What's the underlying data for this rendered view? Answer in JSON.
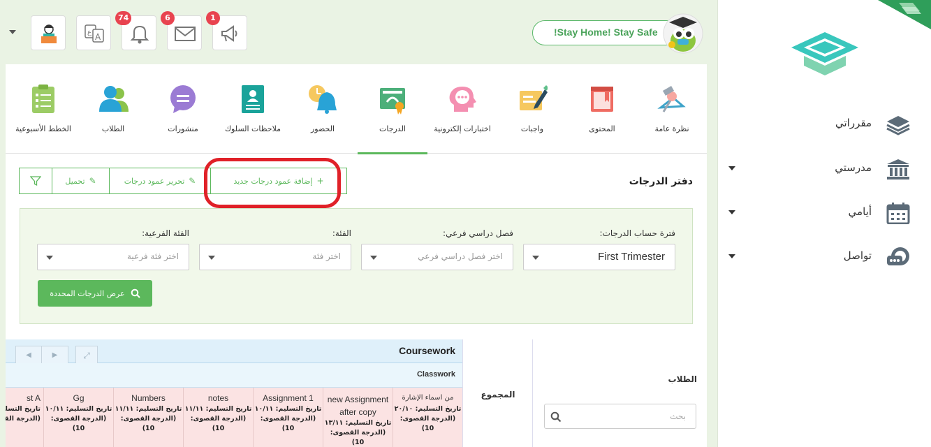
{
  "header": {
    "banner": "!Stay Home! Stay Safe",
    "badges": {
      "notifications": "74",
      "messages": "6",
      "announcements": "1"
    }
  },
  "sidebar": {
    "items": [
      {
        "label": "مقرراتي",
        "icon": "layers-icon"
      },
      {
        "label": "مدرستي",
        "icon": "school-icon"
      },
      {
        "label": "أيامي",
        "icon": "calendar-icon"
      },
      {
        "label": "تواصل",
        "icon": "chat-icon"
      }
    ]
  },
  "nav_tabs": [
    {
      "label": "نظرة عامة",
      "icon": "overview-icon"
    },
    {
      "label": "المحتوى",
      "icon": "book-icon"
    },
    {
      "label": "واجبات",
      "icon": "homework-icon"
    },
    {
      "label": "اختبارات إلكترونية",
      "icon": "quiz-icon"
    },
    {
      "label": "الدرجات",
      "icon": "grades-icon",
      "active": true
    },
    {
      "label": "الحضور",
      "icon": "bell-clock-icon"
    },
    {
      "label": "ملاحظات السلوك",
      "icon": "behavior-icon"
    },
    {
      "label": "منشورات",
      "icon": "posts-icon"
    },
    {
      "label": "الطلاب",
      "icon": "students-icon"
    },
    {
      "label": "الخطط الأسبوعية",
      "icon": "weekly-plan-icon"
    }
  ],
  "gradebook": {
    "title": "دفتر الدرجات",
    "actions": {
      "add_column": "إضافة عمود درجات جديد",
      "edit_column": "تحرير عمود درجات",
      "download": "تحميل"
    },
    "filters": {
      "period_label": "فترة حساب الدرجات:",
      "period_value": "First Trimester",
      "subterm_label": "فصل دراسي فرعي:",
      "subterm_placeholder": "اختر فصل دراسي فرعي",
      "category_label": "الفئة:",
      "category_placeholder": "اختر فئة",
      "subcategory_label": "الفئة الفرعية:",
      "subcategory_placeholder": "اختر فئة فرعية",
      "show_button": "عرض الدرجات المحددة"
    },
    "table": {
      "students_header": "الطلاب",
      "search_placeholder": "بحث",
      "total_header": "المجموع",
      "group_title": "Coursework",
      "subgroup_title": "Classwork",
      "columns": [
        {
          "name": "من اسماء الإشارة",
          "due": "تاريخ التسليم: ٢٠/١٠",
          "max": "(الدرجة القصوى: 10)"
        },
        {
          "name": "new Assignment after copy",
          "due": "تاريخ التسليم: ١٣/١١",
          "max": "(الدرجة القصوى: 10)"
        },
        {
          "name": "Assignment 1",
          "due": "تاريخ التسليم: ١٠/١١",
          "max": "(الدرجة القصوى: 10)"
        },
        {
          "name": "notes",
          "due": "تاريخ التسليم: ١١/١١",
          "max": "(الدرجة القصوى: 10)"
        },
        {
          "name": "Numbers",
          "due": "تاريخ التسليم: ١١/١١",
          "max": "(الدرجة القصوى: 10)"
        },
        {
          "name": "Gg",
          "due": "تاريخ التسليم: ١٠/١١",
          "max": "(الدرجة القصوى: 10)"
        },
        {
          "name": "st A",
          "due": "تاريخ التسليم",
          "max": "(الدرجة القص"
        }
      ]
    }
  }
}
